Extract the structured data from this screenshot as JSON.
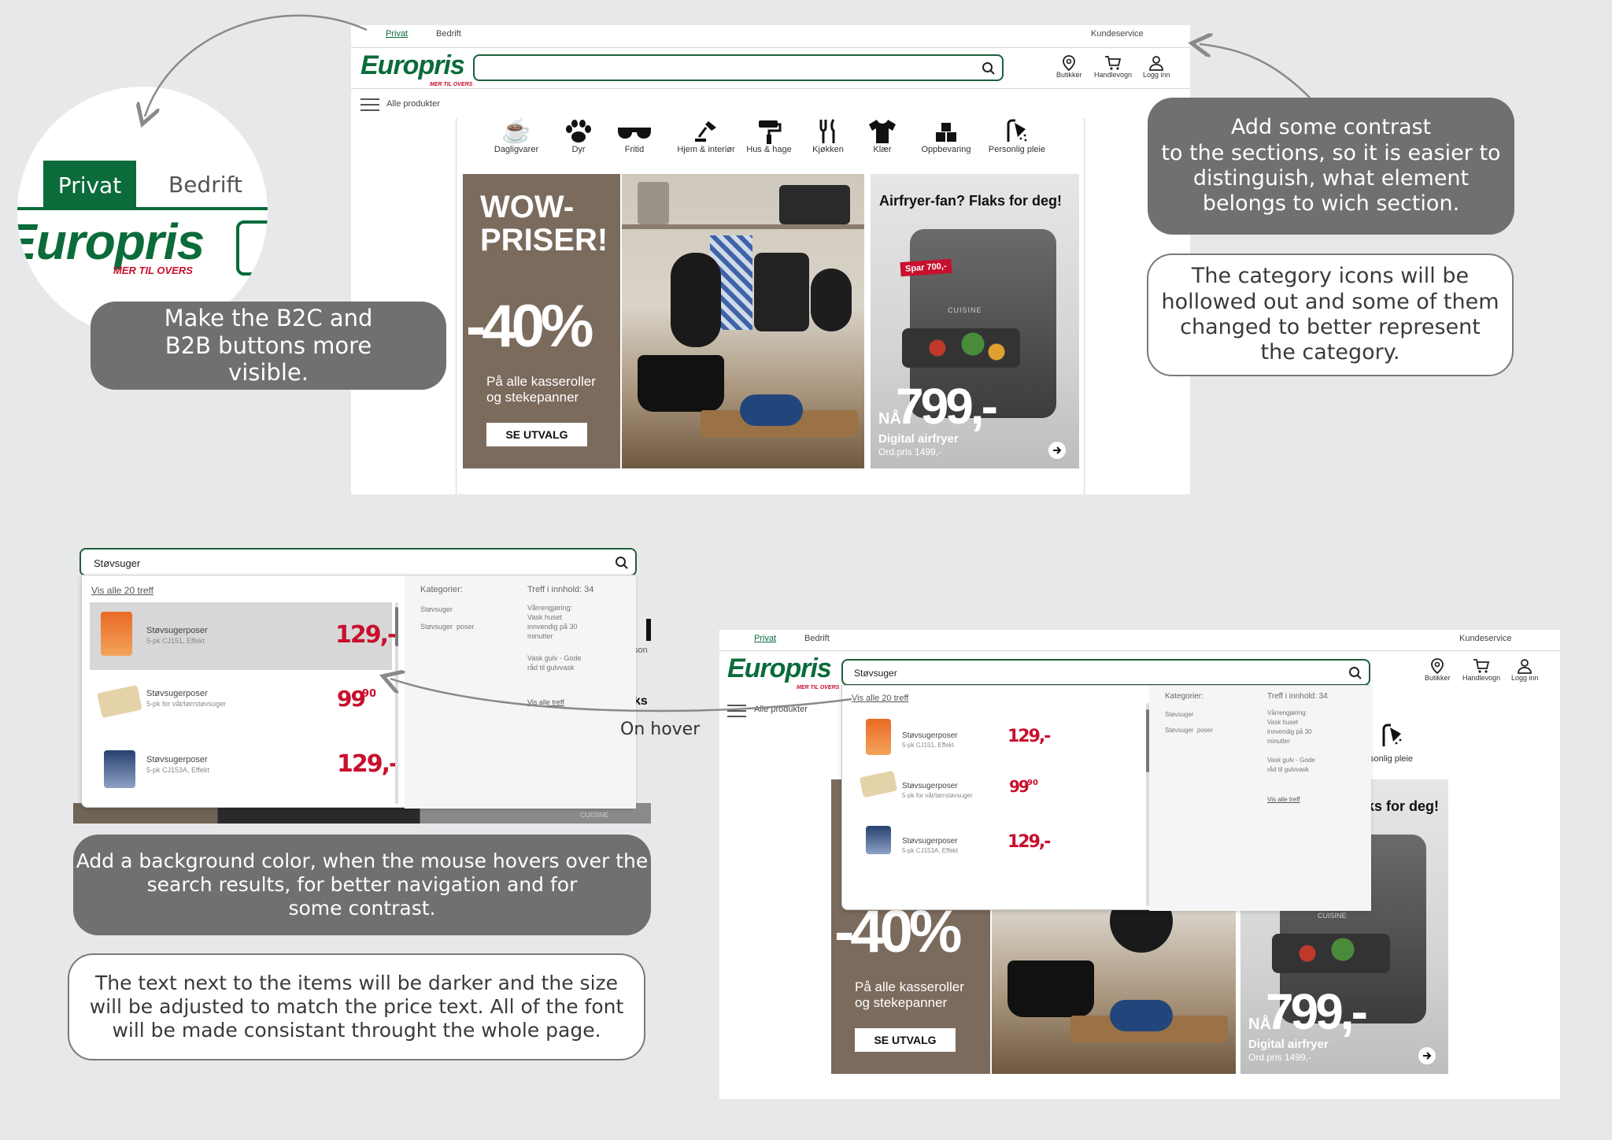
{
  "top_site": {
    "tabs": [
      "Privat",
      "Bedrift"
    ],
    "customer_service": "Kundeservice",
    "logo": "Europris",
    "tagline": "MER TIL OVERS",
    "header_icons": [
      "Butikker",
      "Handlevogn",
      "Logg inn"
    ],
    "all_products": "Alle produkter",
    "categories": [
      {
        "label": "Dagligvarer",
        "icon": "cup-icon"
      },
      {
        "label": "Dyr",
        "icon": "paw-icon"
      },
      {
        "label": "Fritid",
        "icon": "sunglasses-icon"
      },
      {
        "label": "Hjem & interiør",
        "icon": "lamp-icon"
      },
      {
        "label": "Hus & hage",
        "icon": "paint-roller-icon"
      },
      {
        "label": "Kjøkken",
        "icon": "cutlery-icon"
      },
      {
        "label": "Klær",
        "icon": "tshirt-icon"
      },
      {
        "label": "Oppbevaring",
        "icon": "boxes-icon"
      },
      {
        "label": "Personlig pleie",
        "icon": "shower-icon"
      }
    ],
    "promo": {
      "headline_1": "WOW-",
      "headline_2": "PRISER!",
      "discount": "-40%",
      "text_1": "På alle kasseroller",
      "text_2": "og stekepanner",
      "button": "SE UTVALG",
      "airfryer_title": "Airfryer-fan? Flaks for deg!",
      "badge": "Spar 700,-",
      "brand_on_product": "CUISINE",
      "now": "NÅ",
      "price": "799,-",
      "product": "Digital airfryer",
      "ord_price": "Ord.pris 1499,-"
    }
  },
  "zoom_circle": {
    "tab_active": "Privat",
    "tab_inactive": "Bedrift",
    "logo": "Europris",
    "tagline": "MER TIL OVERS"
  },
  "annotations": {
    "b2c": "Make the B2C and B2B buttons more visible.",
    "contrast_1": "Add some contrast",
    "contrast_2": "to the sections, so it is easier to",
    "contrast_3": "distinguish, what element",
    "contrast_4": "belongs to wich section.",
    "icons_1": "The category icons will be",
    "icons_2": "hollowed out and some of them",
    "icons_3": "changed to better represent",
    "icons_4": "the category.",
    "hover_1": "Add a background color, when the mouse hovers over the",
    "hover_2": "search results, for better navigation and for",
    "hover_3": "some contrast.",
    "text_1": "The text next to the items will be darker and the size",
    "text_2": "will be adjusted to match the price text. All of the font",
    "text_3": "will be made consistant throught the whole page.",
    "on_hover": "On hover"
  },
  "search_dropdown": {
    "query": "Støvsuger",
    "show_all": "Vis alle 20 treff",
    "categories_label": "Kategorier:",
    "categories": [
      "Støvsuger",
      "Støvsuger  poser"
    ],
    "content_hits": "Treff i innhold: 34",
    "content_1": [
      "Vårrengjøring:",
      "Vask huset",
      "innvendig på 30",
      "minutter"
    ],
    "content_2": [
      "Vask gulv - Gode",
      "råd til gulvvask"
    ],
    "show_all_hits": "Vis alle treff",
    "items": [
      {
        "name": "Støvsugerposer",
        "desc": "5-pk CJ151, Effekt",
        "price": "129,-"
      },
      {
        "name": "Støvsugerposer",
        "desc": "5-pk for våt/tørrstøvsuger",
        "price": "99",
        "price_sup": "90"
      },
      {
        "name": "Støvsugerposer",
        "desc": "5-pk CJ153A, Effekt",
        "price": "129,-"
      }
    ],
    "peek_text_1": "son",
    "peek_text_2": "ks",
    "peek_brand": "CUISINE"
  },
  "bottom_site": {
    "peek_category": "sonlig pleie",
    "peek_title": "ks for deg!"
  }
}
